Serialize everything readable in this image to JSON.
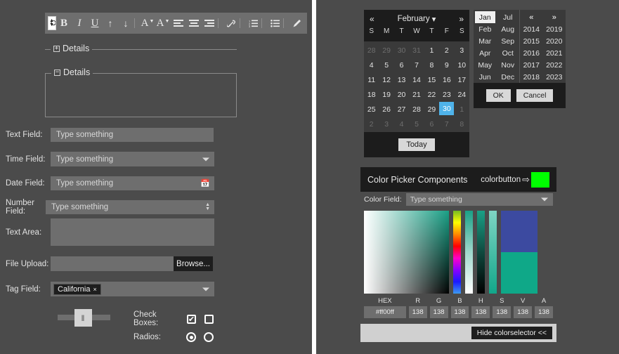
{
  "editor_toolbar": {
    "font_name": "Open Sans",
    "buttons": [
      {
        "name": "bold-button",
        "glyph": "B",
        "style": "bold"
      },
      {
        "name": "italic-button",
        "glyph": "I",
        "style": "italic"
      },
      {
        "name": "underline-button",
        "glyph": "U",
        "style": "underline"
      },
      {
        "name": "increase-font-button",
        "glyph": "↑",
        "style": "plain"
      },
      {
        "name": "decrease-font-button",
        "glyph": "↓",
        "style": "plain"
      },
      {
        "name": "text-color-button",
        "glyph": "A",
        "style": "caret"
      },
      {
        "name": "background-color-button",
        "glyph": "A",
        "style": "caret"
      },
      {
        "name": "align-left-button",
        "glyph": "≡",
        "style": "plain"
      },
      {
        "name": "align-center-button",
        "glyph": "≡",
        "style": "plain"
      },
      {
        "name": "align-right-button",
        "glyph": "≡",
        "style": "plain"
      },
      {
        "name": "link-button",
        "glyph": "✎",
        "style": "plain"
      },
      {
        "name": "ordered-list-button",
        "glyph": "≣",
        "style": "plain"
      },
      {
        "name": "unordered-list-button",
        "glyph": "≣",
        "style": "plain"
      },
      {
        "name": "pencil-button",
        "glyph": "✐",
        "style": "plain"
      }
    ]
  },
  "fieldsets": {
    "collapsed": {
      "legend": "Details",
      "toggle": "+"
    },
    "expanded": {
      "legend": "Details",
      "toggle": "−"
    }
  },
  "form": {
    "text_field": {
      "label": "Text Field:",
      "placeholder": "Type something"
    },
    "time_field": {
      "label": "Time Field:",
      "placeholder": "Type something"
    },
    "date_field": {
      "label": "Date Field:",
      "placeholder": "Type something"
    },
    "number_field": {
      "label": "Number Field:",
      "placeholder": "Type something"
    },
    "text_area": {
      "label": "Text Area:",
      "value": ""
    },
    "file_upload": {
      "label": "File Upload:",
      "value": "",
      "button": "Browse..."
    },
    "tag_field": {
      "label": "Tag Field:",
      "tag": "California",
      "tag_remove": "×"
    },
    "check_boxes": {
      "label": "Check Boxes:",
      "checked_glyph": "✔"
    },
    "radios": {
      "label": "Radios:"
    },
    "slider": {
      "handle_glyph": "‖"
    }
  },
  "calendar": {
    "prev_label": "«",
    "next_label": "»",
    "month": "February",
    "month_caret": "▾",
    "dow": [
      "S",
      "M",
      "T",
      "W",
      "T",
      "F",
      "S"
    ],
    "weeks": [
      [
        {
          "d": "28",
          "m": true
        },
        {
          "d": "29",
          "m": true
        },
        {
          "d": "30",
          "m": true
        },
        {
          "d": "31",
          "m": true
        },
        {
          "d": "1"
        },
        {
          "d": "2"
        },
        {
          "d": "3"
        }
      ],
      [
        {
          "d": "4"
        },
        {
          "d": "5"
        },
        {
          "d": "6"
        },
        {
          "d": "7"
        },
        {
          "d": "8"
        },
        {
          "d": "9"
        },
        {
          "d": "10"
        }
      ],
      [
        {
          "d": "11"
        },
        {
          "d": "12"
        },
        {
          "d": "13"
        },
        {
          "d": "14"
        },
        {
          "d": "15"
        },
        {
          "d": "16"
        },
        {
          "d": "17"
        }
      ],
      [
        {
          "d": "18"
        },
        {
          "d": "19"
        },
        {
          "d": "20"
        },
        {
          "d": "21"
        },
        {
          "d": "22"
        },
        {
          "d": "23"
        },
        {
          "d": "24"
        }
      ],
      [
        {
          "d": "25"
        },
        {
          "d": "26"
        },
        {
          "d": "27"
        },
        {
          "d": "28"
        },
        {
          "d": "29"
        },
        {
          "d": "30",
          "sel": true
        },
        {
          "d": "1",
          "m": true
        }
      ],
      [
        {
          "d": "2",
          "m": true
        },
        {
          "d": "3",
          "m": true
        },
        {
          "d": "4",
          "m": true
        },
        {
          "d": "5",
          "m": true
        },
        {
          "d": "6",
          "m": true
        },
        {
          "d": "7",
          "m": true
        },
        {
          "d": "8",
          "m": true
        }
      ]
    ],
    "today_label": "Today",
    "selected_date": "30",
    "highlight_color": "#4fb3ea"
  },
  "month_year_picker": {
    "months_col1": [
      "Jan",
      "Feb",
      "Mar",
      "Apr",
      "May",
      "Jun"
    ],
    "months_col2": [
      "Jul",
      "Aug",
      "Sep",
      "Oct",
      "Nov",
      "Dec"
    ],
    "selected_month": "Jan",
    "years_prev": "«",
    "years_next": "»",
    "years_col1": [
      "2014",
      "2015",
      "2016",
      "2017",
      "2018"
    ],
    "years_col2": [
      "2019",
      "2020",
      "2021",
      "2022",
      "2023"
    ],
    "ok_label": "OK",
    "cancel_label": "Cancel"
  },
  "color_picker": {
    "title": "Color Picker Components",
    "colorbutton_label": "colorbutton",
    "arrow_glyph": "⇨",
    "swatch_color": "#00ff00",
    "color_field_label": "Color Field:",
    "color_field_placeholder": "Type something",
    "channel_headers": [
      "HEX",
      "R",
      "G",
      "B",
      "H",
      "S",
      "V",
      "A"
    ],
    "hex_value": "#ff00ff",
    "r": "138",
    "g": "138",
    "b": "138",
    "h": "138",
    "s": "138",
    "v": "138",
    "a": "138",
    "hide_button": "Hide colorselector <<"
  }
}
